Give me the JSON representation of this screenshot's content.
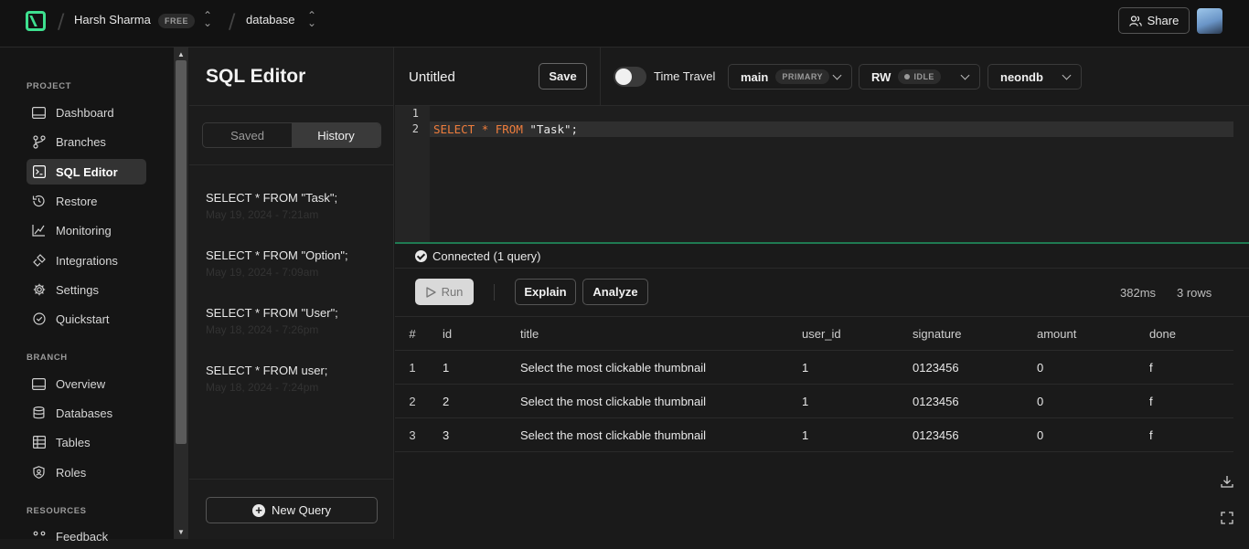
{
  "topbar": {
    "project_name": "Harsh Sharma",
    "plan_badge": "FREE",
    "database_name": "database",
    "share_label": "Share"
  },
  "sidebar": {
    "sections": [
      {
        "label": "PROJECT"
      },
      {
        "label": "BRANCH"
      },
      {
        "label": "RESOURCES"
      }
    ],
    "project_items": [
      {
        "label": "Dashboard",
        "icon": "dashboard-icon"
      },
      {
        "label": "Branches",
        "icon": "branch-icon"
      },
      {
        "label": "SQL Editor",
        "icon": "sql-editor-icon",
        "active": true
      },
      {
        "label": "Restore",
        "icon": "restore-icon"
      },
      {
        "label": "Monitoring",
        "icon": "monitoring-icon"
      },
      {
        "label": "Integrations",
        "icon": "integrations-icon"
      },
      {
        "label": "Settings",
        "icon": "gear-icon"
      },
      {
        "label": "Quickstart",
        "icon": "check-circle-icon"
      }
    ],
    "branch_items": [
      {
        "label": "Overview",
        "icon": "overview-icon"
      },
      {
        "label": "Databases",
        "icon": "database-icon"
      },
      {
        "label": "Tables",
        "icon": "table-icon"
      },
      {
        "label": "Roles",
        "icon": "shield-icon"
      }
    ],
    "resource_items": [
      {
        "label": "Feedback",
        "icon": "feedback-icon"
      }
    ]
  },
  "sql_panel": {
    "title": "SQL Editor",
    "tabs": [
      {
        "label": "Saved",
        "active": false
      },
      {
        "label": "History",
        "active": true
      }
    ],
    "history": [
      {
        "query": "SELECT * FROM \"Task\";",
        "time": "May 19, 2024 - 7:21am"
      },
      {
        "query": "SELECT * FROM \"Option\";",
        "time": "May 19, 2024 - 7:09am"
      },
      {
        "query": "SELECT * FROM \"User\";",
        "time": "May 18, 2024 - 7:26pm"
      },
      {
        "query": "SELECT * FROM user;",
        "time": "May 18, 2024 - 7:24pm"
      }
    ],
    "new_query_label": "New Query"
  },
  "toolbar": {
    "query_title": "Untitled",
    "save_label": "Save",
    "time_travel_label": "Time Travel",
    "time_travel_on": false,
    "branch": {
      "value": "main",
      "badge": "PRIMARY"
    },
    "compute": {
      "value": "RW",
      "badge": "IDLE"
    },
    "database": {
      "value": "neondb"
    }
  },
  "editor": {
    "lines": [
      "",
      "SELECT * FROM \"Task\";"
    ],
    "line_numbers": [
      "1",
      "2"
    ]
  },
  "status": {
    "text": "Connected (1 query)"
  },
  "runbar": {
    "run_label": "Run",
    "explain_label": "Explain",
    "analyze_label": "Analyze",
    "duration": "382ms",
    "row_count": "3 rows"
  },
  "results": {
    "columns": [
      "#",
      "id",
      "title",
      "user_id",
      "signature",
      "amount",
      "done"
    ],
    "rows": [
      [
        "1",
        "1",
        "Select the most clickable thumbnail",
        "1",
        "0123456",
        "0",
        "f"
      ],
      [
        "2",
        "2",
        "Select the most clickable thumbnail",
        "1",
        "0123456",
        "0",
        "f"
      ],
      [
        "3",
        "3",
        "Select the most clickable thumbnail",
        "1",
        "0123456",
        "0",
        "f"
      ]
    ]
  },
  "colors": {
    "accent": "#3ee08f",
    "keyword": "#ef7d3c",
    "connected_border": "#1f7a52"
  }
}
